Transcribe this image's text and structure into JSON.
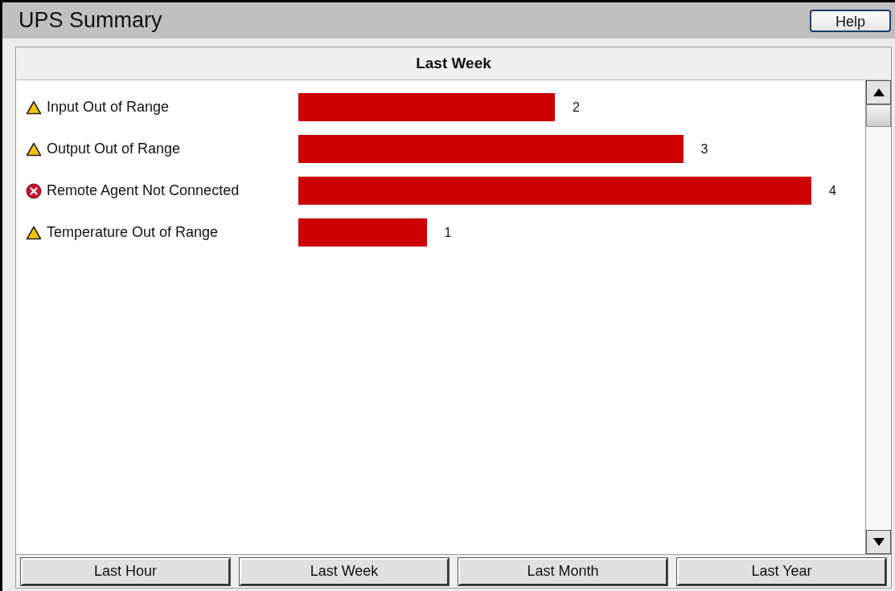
{
  "window": {
    "title": "UPS Summary",
    "help_button": "Help"
  },
  "panel": {
    "rows": [
      {
        "kind": "warning"
      },
      {
        "kind": "warning"
      },
      {
        "kind": "error"
      },
      {
        "kind": "warning"
      }
    ],
    "chart_data": {
      "type": "bar",
      "orientation": "horizontal",
      "categories": [
        "Input Out of Range",
        "Output Out of Range",
        "Remote Agent Not Connected",
        "Temperature Out of Range"
      ],
      "series": [
        {
          "name": "Last Week",
          "color": "#cc0000",
          "values": [
            2,
            3,
            4,
            1
          ]
        }
      ],
      "data_labels": true
    }
  },
  "range_buttons": [
    "Last Hour",
    "Last Week",
    "Last Month",
    "Last Year"
  ]
}
